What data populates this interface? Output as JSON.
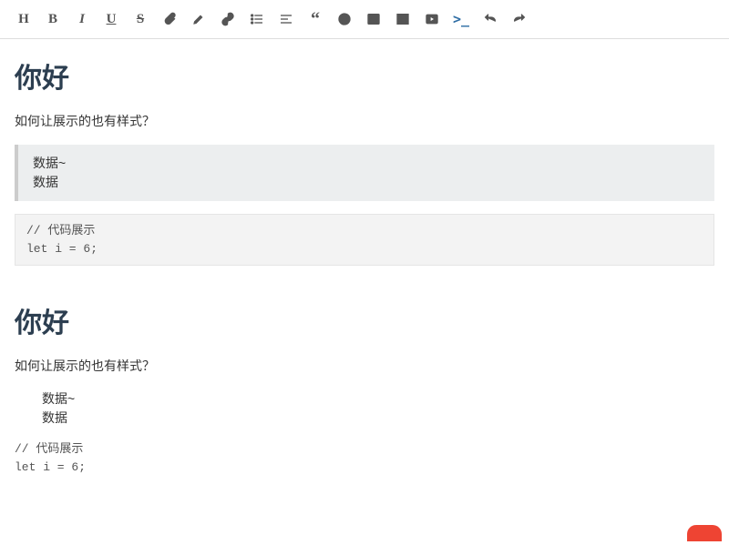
{
  "toolbar": {
    "buttons": [
      {
        "name": "heading",
        "label": "H"
      },
      {
        "name": "bold",
        "label": "B"
      },
      {
        "name": "italic",
        "label": "I"
      },
      {
        "name": "underline",
        "label": "U"
      },
      {
        "name": "strikethrough",
        "label": "S"
      },
      {
        "name": "clip",
        "label": ""
      },
      {
        "name": "highlight",
        "label": ""
      },
      {
        "name": "link",
        "label": ""
      },
      {
        "name": "list",
        "label": ""
      },
      {
        "name": "align",
        "label": ""
      },
      {
        "name": "quote",
        "label": ""
      },
      {
        "name": "emoji",
        "label": ""
      },
      {
        "name": "image",
        "label": ""
      },
      {
        "name": "table",
        "label": ""
      },
      {
        "name": "video",
        "label": ""
      },
      {
        "name": "terminal",
        "label": ">_"
      },
      {
        "name": "undo",
        "label": ""
      },
      {
        "name": "redo",
        "label": ""
      }
    ]
  },
  "editor": {
    "heading": "你好",
    "paragraph": "如何让展示的也有样式？",
    "blockquote_line1": "数据~",
    "blockquote_line2": "数据",
    "code_line1": "// 代码展示",
    "code_line2": "let i = 6;"
  },
  "preview": {
    "heading": "你好",
    "paragraph": "如何让展示的也有样式？",
    "blockquote_line1": "数据~",
    "blockquote_line2": "数据",
    "code_line1": "// 代码展示",
    "code_line2": "let i = 6;"
  }
}
